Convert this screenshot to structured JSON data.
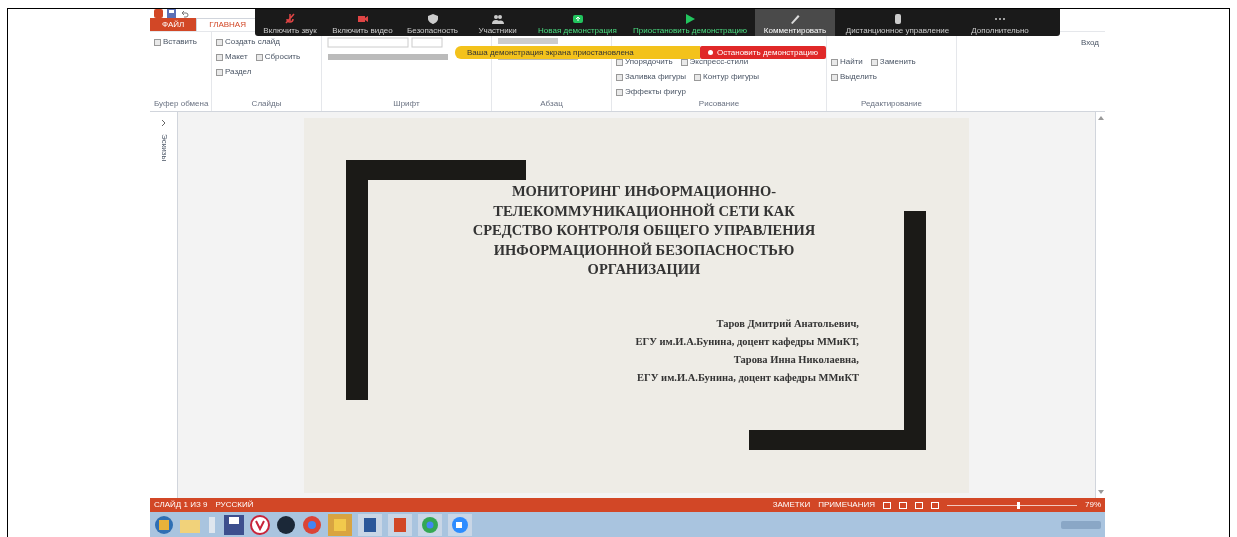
{
  "ribbon": {
    "tabs": [
      {
        "label": "ФАЙЛ",
        "kind": "file",
        "selected": false
      },
      {
        "label": "ГЛАВНАЯ",
        "kind": "tab",
        "selected": true
      }
    ],
    "sign_in": "Вход",
    "groups": [
      {
        "label": "Буфер обмена",
        "items": [
          "Вставить"
        ]
      },
      {
        "label": "Слайды",
        "items": [
          "Создать слайд",
          "Макет",
          "Сбросить",
          "Раздел"
        ]
      },
      {
        "label": "Шрифт"
      },
      {
        "label": "Абзац"
      },
      {
        "label": "Рисование",
        "items": [
          "Упорядочить",
          "Экспресс-стили",
          "Заливка фигуры",
          "Контур фигуры",
          "Эффекты фигур"
        ]
      },
      {
        "label": "Редактирование",
        "items": [
          "Найти",
          "Заменить",
          "Выделить"
        ]
      }
    ]
  },
  "zoom_toolbar": {
    "items": [
      {
        "label": "Включить звук",
        "kind": "normal"
      },
      {
        "label": "Включить видео",
        "kind": "normal"
      },
      {
        "label": "Безопасность",
        "kind": "normal"
      },
      {
        "label": "Участники",
        "kind": "normal"
      },
      {
        "label": "Новая демонстрация",
        "kind": "share"
      },
      {
        "label": "Приостановить демонстрацию",
        "kind": "share"
      },
      {
        "label": "Комментировать",
        "kind": "active"
      },
      {
        "label": "Дистанционное управление",
        "kind": "normal"
      },
      {
        "label": "Дополнительно",
        "kind": "normal"
      }
    ],
    "banner": "Ваша демонстрация экрана приостановлена",
    "stop_button": "Остановить демонстрацию"
  },
  "thumbnails_pane": {
    "label": "Эскизы"
  },
  "slide": {
    "title": "МОНИТОРИНГ ИНФОРМАЦИОННО-ТЕЛЕКОММУНИКАЦИОННОЙ СЕТИ КАК СРЕДСТВО КОНТРОЛЯ ОБЩЕГО УПРАВЛЕНИЯ ИНФОРМАЦИОННОЙ БЕЗОПАСНОСТЬЮ ОРГАНИЗАЦИИ",
    "authors": [
      "Таров Дмитрий Анатольевич,",
      "ЕГУ им.И.А.Бунина, доцент кафедры ММиКТ,",
      "Тарова Инна Николаевна,",
      "ЕГУ им.И.А.Бунина, доцент кафедры ММиКТ"
    ]
  },
  "status_bar": {
    "slide_count": "СЛАЙД 1 ИЗ 9",
    "language": "РУССКИЙ",
    "notes": "ЗАМЕТКИ",
    "comments": "ПРИМЕЧАНИЯ",
    "zoom": {
      "level": 0.55,
      "reading": "79%"
    }
  }
}
